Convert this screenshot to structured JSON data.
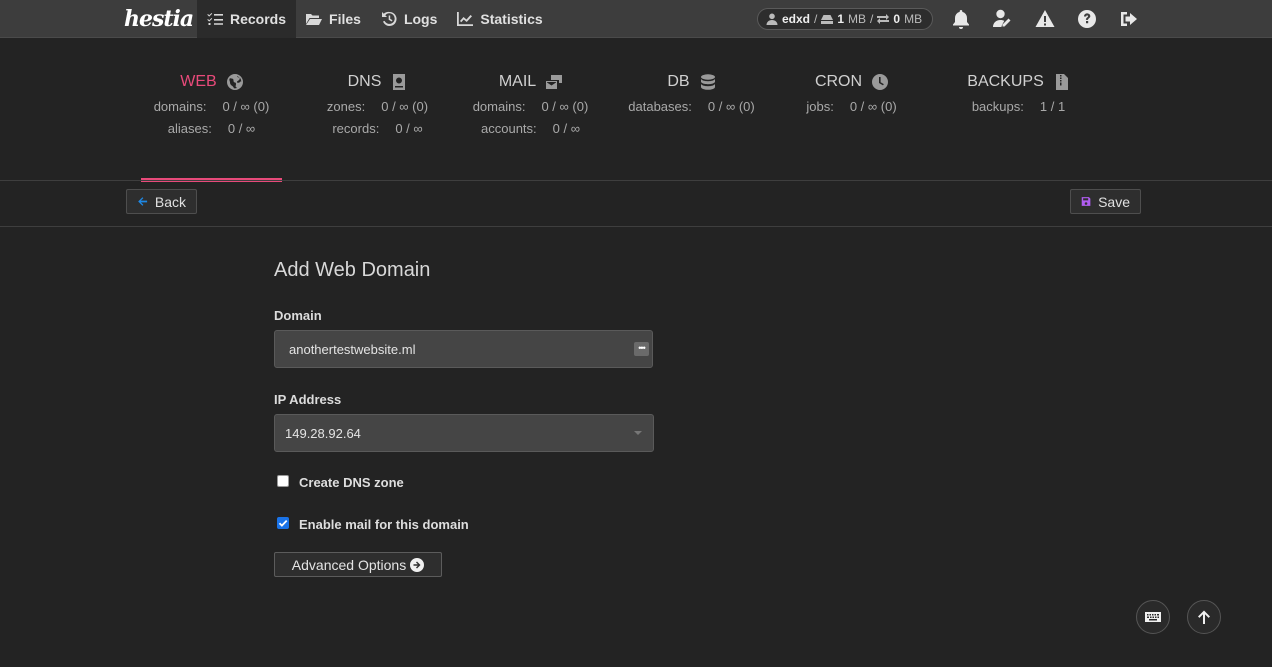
{
  "app": {
    "logo": "hestia"
  },
  "nav": [
    {
      "label": "Records",
      "icon": "list-check-icon",
      "active": true
    },
    {
      "label": "Files",
      "icon": "folder-open-icon",
      "active": false
    },
    {
      "label": "Logs",
      "icon": "history-icon",
      "active": false
    },
    {
      "label": "Statistics",
      "icon": "chart-line-icon",
      "active": false
    }
  ],
  "user": {
    "name": "edxd",
    "disk_value": "1",
    "disk_unit": "MB",
    "bandwidth_value": "0",
    "bandwidth_unit": "MB",
    "separator": "/"
  },
  "top_icons": [
    "bell-icon",
    "user-edit-icon",
    "warning-icon",
    "help-icon",
    "logout-icon"
  ],
  "stats": [
    {
      "title": "WEB",
      "icon": "globe-icon",
      "active": true,
      "rows": [
        {
          "label": "domains:",
          "value": "0 / ∞ (0)"
        },
        {
          "label": "aliases:",
          "value": "0 / ∞"
        }
      ]
    },
    {
      "title": "DNS",
      "icon": "address-book-icon",
      "active": false,
      "rows": [
        {
          "label": "zones:",
          "value": "0 / ∞ (0)"
        },
        {
          "label": "records:",
          "value": "0 / ∞"
        }
      ]
    },
    {
      "title": "MAIL",
      "icon": "mail-bulk-icon",
      "active": false,
      "rows": [
        {
          "label": "domains:",
          "value": "0 / ∞ (0)"
        },
        {
          "label": "accounts:",
          "value": "0 / ∞"
        }
      ]
    },
    {
      "title": "DB",
      "icon": "database-icon",
      "active": false,
      "rows": [
        {
          "label": "databases:",
          "value": "0 / ∞ (0)"
        }
      ]
    },
    {
      "title": "CRON",
      "icon": "clock-icon",
      "active": false,
      "rows": [
        {
          "label": "jobs:",
          "value": "0 / ∞ (0)"
        }
      ]
    },
    {
      "title": "BACKUPS",
      "icon": "file-archive-icon",
      "active": false,
      "rows": [
        {
          "label": "backups:",
          "value": "1 / 1"
        }
      ]
    }
  ],
  "toolbar": {
    "back_label": "Back",
    "save_label": "Save"
  },
  "form": {
    "title": "Add Web Domain",
    "domain_label": "Domain",
    "domain_value": "anothertestwebsite.ml",
    "ip_label": "IP Address",
    "ip_value": "149.28.92.64",
    "dns_zone_label": "Create DNS zone",
    "dns_zone_checked": false,
    "mail_label": "Enable mail for this domain",
    "mail_checked": true,
    "advanced_label": "Advanced Options"
  },
  "colors": {
    "accent": "#e84a7a",
    "back_arrow": "#1e88e5",
    "save_icon": "#b05cf0",
    "checkbox": "#1a73e8"
  }
}
